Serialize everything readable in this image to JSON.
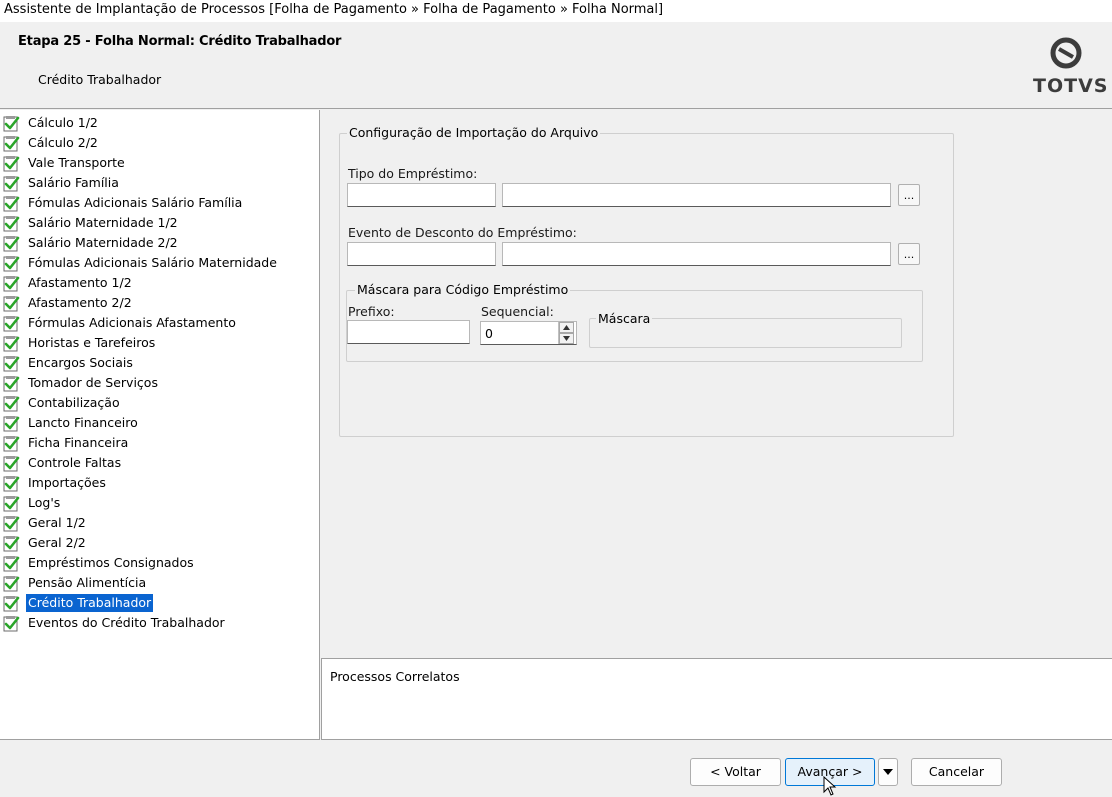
{
  "window": {
    "title": "Assistente de Implantação de Processos [Folha de Pagamento » Folha de Pagamento » Folha Normal]"
  },
  "header": {
    "step_title": "Etapa 25 - Folha Normal: Crédito Trabalhador",
    "step_subtitle": "Crédito Trabalhador",
    "logo_text": "TOTVS"
  },
  "tree": {
    "items": [
      {
        "label": "Cálculo 1/2",
        "status": "check"
      },
      {
        "label": "Cálculo 2/2",
        "status": "check"
      },
      {
        "label": "Vale Transporte",
        "status": "check"
      },
      {
        "label": "Salário Família",
        "status": "check"
      },
      {
        "label": "Fómulas Adicionais Salário Família",
        "status": "check"
      },
      {
        "label": "Salário Maternidade 1/2",
        "status": "check"
      },
      {
        "label": "Salário Maternidade 2/2",
        "status": "check"
      },
      {
        "label": "Fómulas Adicionais Salário Maternidade",
        "status": "check"
      },
      {
        "label": "Afastamento 1/2",
        "status": "check"
      },
      {
        "label": "Afastamento 2/2",
        "status": "check"
      },
      {
        "label": "Fórmulas Adicionais Afastamento",
        "status": "check"
      },
      {
        "label": "Horistas e Tarefeiros",
        "status": "check"
      },
      {
        "label": "Encargos Sociais",
        "status": "check"
      },
      {
        "label": "Tomador de Serviços",
        "status": "check"
      },
      {
        "label": "Contabilização",
        "status": "check"
      },
      {
        "label": "Lancto Financeiro",
        "status": "check"
      },
      {
        "label": "Ficha Financeira",
        "status": "check"
      },
      {
        "label": "Controle Faltas",
        "status": "check"
      },
      {
        "label": "Importações",
        "status": "check"
      },
      {
        "label": "Log's",
        "status": "check"
      },
      {
        "label": "Geral 1/2",
        "status": "check"
      },
      {
        "label": "Geral 2/2",
        "status": "check"
      },
      {
        "label": "Empréstimos Consignados",
        "status": "check"
      },
      {
        "label": "Pensão Alimentícia",
        "status": "check"
      },
      {
        "label": "Crédito Trabalhador",
        "status": "check",
        "selected": true
      },
      {
        "label": "Eventos do Crédito Trabalhador",
        "status": "check"
      }
    ]
  },
  "form": {
    "group_title": "Configuração de Importação do Arquivo",
    "tipo_label": "Tipo do Empréstimo:",
    "tipo_code": "",
    "tipo_desc": "",
    "evento_label": "Evento de Desconto do Empréstimo:",
    "evento_code": "",
    "evento_desc": "",
    "lookup_btn": "...",
    "mascara_group_title": "Máscara para Código Empréstimo",
    "prefixo_label": "Prefixo:",
    "prefixo_value": "",
    "sequencial_label": "Sequencial:",
    "sequencial_value": "0",
    "mascara_label": "Máscara"
  },
  "correlatos": {
    "title": "Processos Correlatos"
  },
  "footer": {
    "voltar": "< Voltar",
    "avancar": "Avançar >",
    "cancelar": "Cancelar"
  },
  "colors": {
    "selection": "#0a64d0",
    "check_green": "#2aa52a",
    "primary_border": "#0078d7"
  }
}
